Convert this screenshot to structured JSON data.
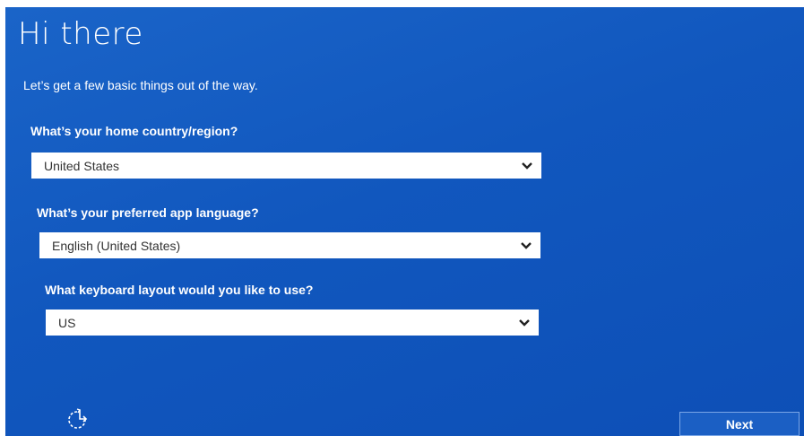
{
  "page": {
    "title": "Hi there",
    "subtitle": "Let’s get a few basic things out of the way."
  },
  "fields": [
    {
      "label": "What’s your home country/region?",
      "value": "United States"
    },
    {
      "label": "What’s your preferred app language?",
      "value": "English (United States)"
    },
    {
      "label": "What keyboard layout would you like to use?",
      "value": "US"
    }
  ],
  "footer": {
    "next_label": "Next",
    "accessibility_icon": "ease-of-access-icon"
  },
  "icons": {
    "dropdown": "chevron-down-icon"
  },
  "colors": {
    "background": "#1157be",
    "dropdown_bg": "#ffffff",
    "text": "#ffffff"
  }
}
